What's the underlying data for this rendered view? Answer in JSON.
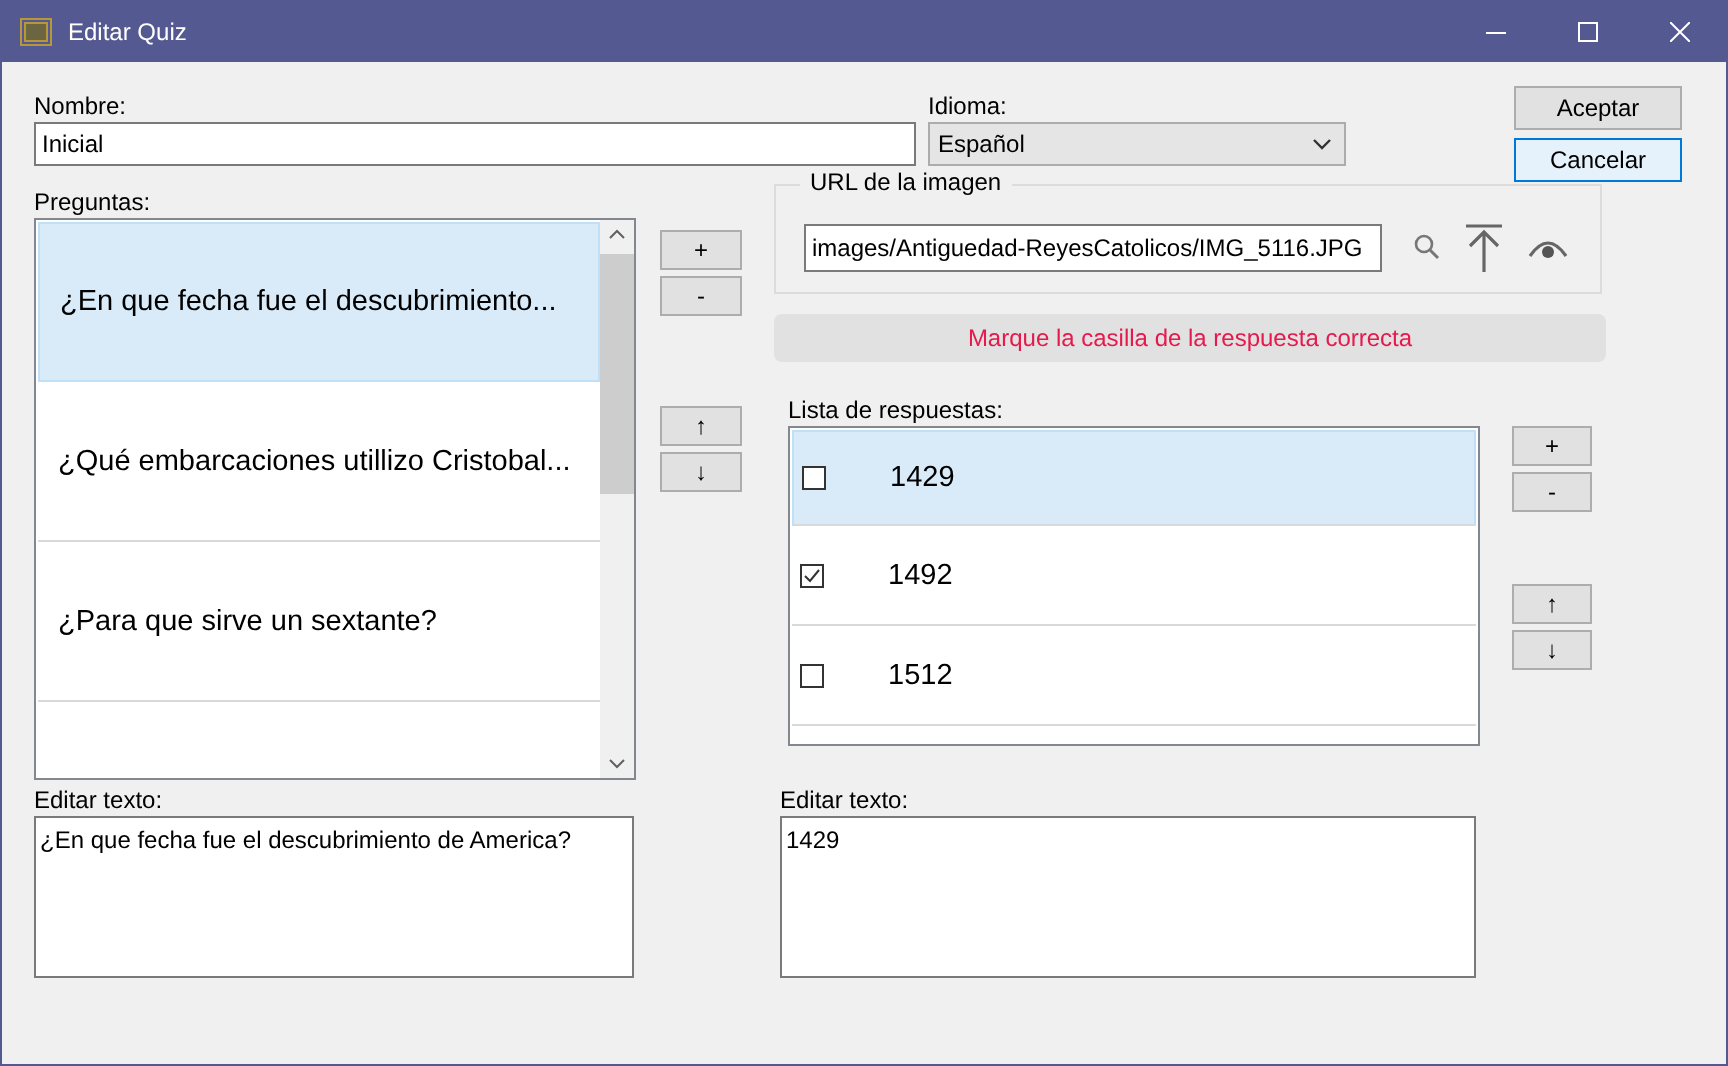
{
  "window": {
    "title": "Editar Quiz"
  },
  "nombre": {
    "label": "Nombre:",
    "value": "Inicial"
  },
  "idioma": {
    "label": "Idioma:",
    "value": "Español"
  },
  "dialog_buttons": [
    {
      "label": "Aceptar",
      "focused": false
    },
    {
      "label": "Cancelar",
      "focused": true
    }
  ],
  "preguntas": {
    "label": "Preguntas:",
    "items": [
      {
        "text": "¿En que fecha fue el descubrimiento...",
        "selected": true
      },
      {
        "text": "¿Qué embarcaciones utillizo Cristobal...",
        "selected": false
      },
      {
        "text": "¿Para que sirve un sextante?",
        "selected": false
      }
    ]
  },
  "question_buttons": [
    "+",
    "-",
    "↑",
    "↓"
  ],
  "image_url": {
    "legend": "URL de la imagen",
    "value": "images/Antiguedad-ReyesCatolicos/IMG_5116.JPG"
  },
  "message": "Marque la casilla de la respuesta correcta",
  "respuestas": {
    "label": "Lista de respuestas:",
    "items": [
      {
        "text": "1429",
        "checked": false,
        "selected": true
      },
      {
        "text": "1492",
        "checked": true,
        "selected": false
      },
      {
        "text": "1512",
        "checked": false,
        "selected": false
      }
    ]
  },
  "answer_buttons": [
    "+",
    "-",
    "↑",
    "↓"
  ],
  "editors": [
    {
      "label": "Editar texto:",
      "value": "¿En que fecha fue el descubrimiento de America?"
    },
    {
      "label": "Editar texto:",
      "value": "1429"
    }
  ]
}
